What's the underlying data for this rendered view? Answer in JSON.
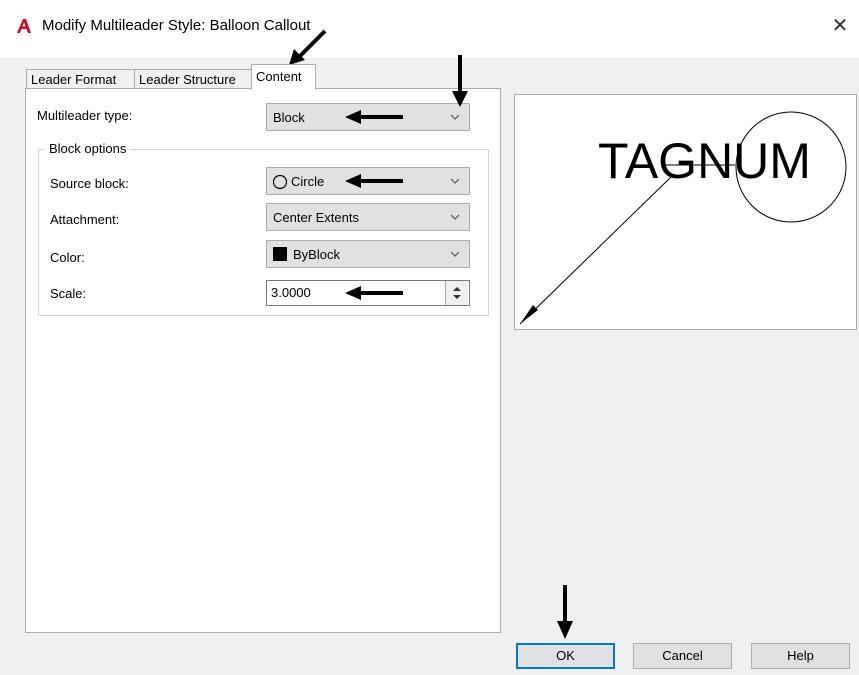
{
  "window": {
    "title": "Modify Multileader Style: Balloon Callout",
    "close_symbol": "✕",
    "app_icon": "autocad-logo-icon",
    "accent_color": "#0078d7",
    "logo_color": "#c8102e"
  },
  "tabs": [
    {
      "label": "Leader Format",
      "active": false
    },
    {
      "label": "Leader Structure",
      "active": false
    },
    {
      "label": "Content",
      "active": true
    }
  ],
  "content": {
    "multileader_type": {
      "label": "Multileader type:",
      "value": "Block"
    },
    "block_options": {
      "title": "Block options",
      "source_block": {
        "label": "Source block:",
        "value": "Circle",
        "icon": "circle-icon"
      },
      "attachment": {
        "label": "Attachment:",
        "value": "Center Extents"
      },
      "color": {
        "label": "Color:",
        "value": "ByBlock",
        "swatch": "#000000"
      },
      "scale": {
        "label": "Scale:",
        "value": "3.0000"
      }
    }
  },
  "preview": {
    "text": "TAGNUM"
  },
  "buttons": {
    "ok": "OK",
    "cancel": "Cancel",
    "help": "Help"
  }
}
